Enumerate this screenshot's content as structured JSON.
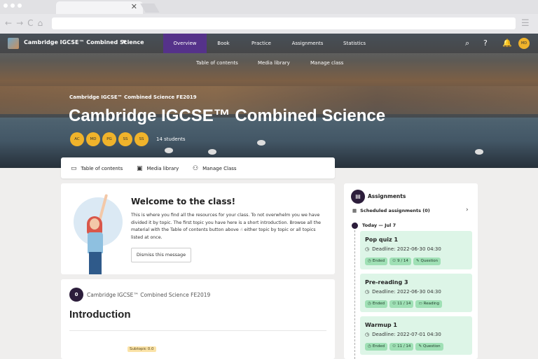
{
  "topnav": {
    "brand": "Cambridge IGCSE™ Combined Science",
    "items": [
      {
        "label": "Overview"
      },
      {
        "label": "Book"
      },
      {
        "label": "Practice"
      },
      {
        "label": "Assignments"
      },
      {
        "label": "Statistics"
      }
    ],
    "avatar": "MD"
  },
  "subnav": [
    "Table of contents",
    "Media library",
    "Manage class"
  ],
  "hero": {
    "course_small": "Cambridge IGCSE™ Combined Science FE2019",
    "title": "Cambridge IGCSE™ Combined Science",
    "students": [
      "AC",
      "MD",
      "PG",
      "SS",
      "SS"
    ],
    "student_count": "14 students"
  },
  "quicklinks": [
    "Table of contents",
    "Media library",
    "Manage Class"
  ],
  "welcome": {
    "title": "Welcome to the class!",
    "text": "This is where you find all the resources for your class. To not overwhelm you we have divided it by topic. The first topic you have here is a short introduction. Browse all the material with the Table of contents button above ☝ either topic by topic or all topics listed at once.",
    "dismiss": "Dismiss this message"
  },
  "intro": {
    "number": "0",
    "course": "Cambridge IGCSE™ Combined Science FE2019",
    "title": "Introduction",
    "subtopic": "Subtopic 0.0"
  },
  "assignments": {
    "title": "Assignments",
    "scheduled": "Scheduled assignments (0)",
    "today": "Today — Jul 7",
    "items": [
      {
        "title": "Pop quiz 1",
        "deadline": "Deadline: 2022-06-30 04:30",
        "status": "Ended",
        "count": "9 / 14",
        "type": "Question"
      },
      {
        "title": "Pre-reading 3",
        "deadline": "Deadline: 2022-06-30 04:30",
        "status": "Ended",
        "count": "11 / 14",
        "type": "Reading"
      },
      {
        "title": "Warmup 1",
        "deadline": "Deadline: 2022-07-01 04:30",
        "status": "Ended",
        "count": "11 / 14",
        "type": "Question"
      }
    ]
  }
}
